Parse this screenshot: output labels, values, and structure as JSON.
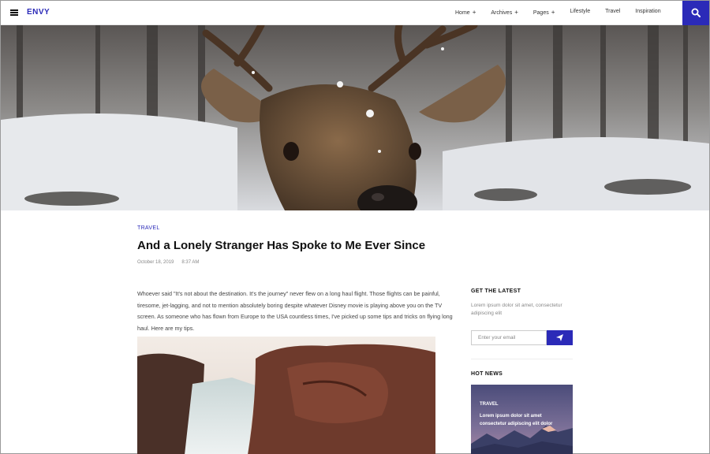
{
  "header": {
    "logo": "ENVY",
    "nav": [
      {
        "label": "Home",
        "has_submenu": true
      },
      {
        "label": "Archives",
        "has_submenu": true
      },
      {
        "label": "Pages",
        "has_submenu": true
      },
      {
        "label": "Lifestyle",
        "has_submenu": false
      },
      {
        "label": "Travel",
        "has_submenu": false
      },
      {
        "label": "Inspiration",
        "has_submenu": false
      }
    ],
    "submenu_marker": "+",
    "menu_icon": "hamburger-icon",
    "search_icon": "search-icon"
  },
  "hero": {
    "image": "deer-in-snowy-forest"
  },
  "article": {
    "category": "TRAVEL",
    "title": "And a Lonely Stranger Has Spoke to Me Ever Since",
    "date": "October 18, 2019",
    "time": "8:37 AM",
    "body": "Whoever said \"It's not about the destination. It's the journey\" never flew on a long haul flight. Those flights can be painful, tiresome, jet-lagging, and not to mention absolutely boring despite whatever Disney movie is playing above you on the TV screen. As someone who has flown from Europe to the USA countless times, I've picked up some tips and tricks on flying long haul. Here are my tips.",
    "image": "waterfall-between-rocks"
  },
  "sidebar": {
    "latest_heading": "GET THE LATEST",
    "latest_desc": "Lorem ipsum dolor sit amet, consectetur adipiscing elit",
    "email_placeholder": "Enter your email",
    "send_icon": "paper-plane-icon",
    "hot_heading": "HOT NEWS",
    "hot_card": {
      "category": "TRAVEL",
      "title": "Lorem ipsum dolor sit amet consectetur adipiscing elit dolor",
      "image": "mountains-at-dusk"
    }
  },
  "colors": {
    "accent": "#2b2ab8",
    "text": "#222222",
    "muted": "#888888"
  }
}
